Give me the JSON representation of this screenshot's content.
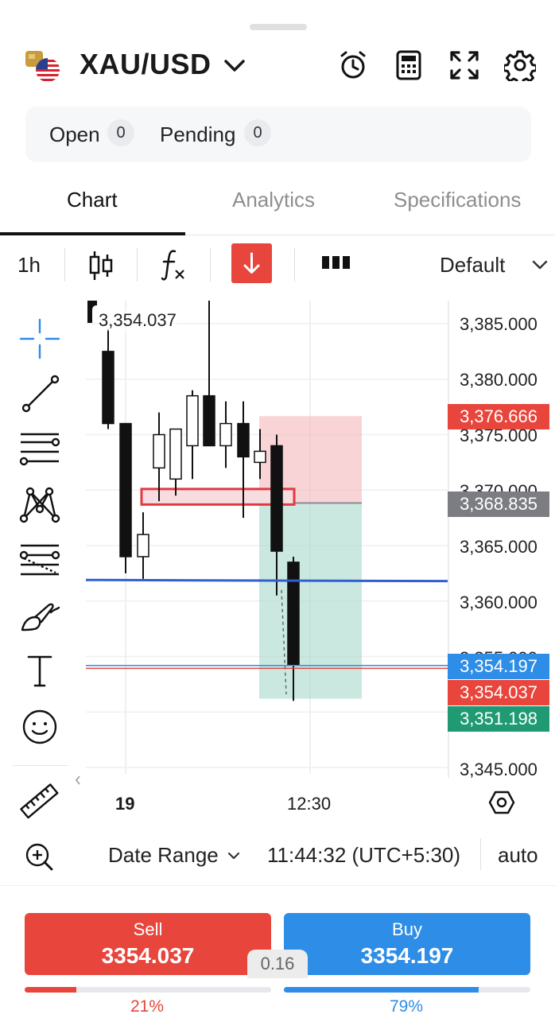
{
  "header": {
    "symbol": "XAU/USD",
    "icons": [
      "coin-flag-icon",
      "chevron-down-icon",
      "alarm-clock-icon",
      "calculator-icon",
      "fullscreen-icon",
      "gear-icon"
    ]
  },
  "orders": {
    "open_label": "Open",
    "open_count": "0",
    "pending_label": "Pending",
    "pending_count": "0"
  },
  "tabs": [
    {
      "label": "Chart",
      "active": true
    },
    {
      "label": "Analytics",
      "active": false
    },
    {
      "label": "Specifications",
      "active": false
    }
  ],
  "toolbar": {
    "interval": "1h",
    "icons": [
      "candlestick-icon",
      "function-icon",
      "sell-arrow-icon",
      "bars-icon",
      "chevron-down-icon"
    ],
    "template": "Default"
  },
  "drawing_tools": [
    "crosshair-icon",
    "trendline-icon",
    "horizontal-lines-icon",
    "pattern-icon",
    "fib-icon",
    "brush-icon",
    "text-icon",
    "emoji-icon",
    "ruler-icon",
    "zoom-in-icon"
  ],
  "chart": {
    "crosshair_price": "3,354.037",
    "y_labels": [
      "3,385.000",
      "3,380.000",
      "3,375.000",
      "3,370.000",
      "3,365.000",
      "3,360.000",
      "3,355.000",
      "3,345.000"
    ],
    "x_labels": [
      "19",
      "12:30"
    ],
    "price_tags": [
      {
        "text": "3,376.666",
        "color": "#e8453c"
      },
      {
        "text": "3,368.835",
        "color": "#7b7d82"
      },
      {
        "text": "3,354.197",
        "color": "#2e8de6"
      },
      {
        "text": "3,354.037",
        "color": "#e8453c"
      },
      {
        "text": "3,351.198",
        "color": "#1f9a73"
      }
    ],
    "colors": {
      "buy": "#2e8de6",
      "sell": "#e8453c",
      "level_line": "#2f5fd0",
      "target": "#1f9a73"
    }
  },
  "chart_data": {
    "type": "candlestick",
    "x_axis_labels": [
      "19",
      "12:30"
    ],
    "ylim": [
      3343,
      3387
    ],
    "candles": [
      {
        "open": 3382.5,
        "high": 3384.5,
        "low": 3375.5,
        "close": 3376.0
      },
      {
        "open": 3376.0,
        "high": 3376.0,
        "low": 3362.5,
        "close": 3364.0
      },
      {
        "open": 3364.0,
        "high": 3368.0,
        "low": 3362.0,
        "close": 3366.0
      },
      {
        "open": 3372.0,
        "high": 3377.0,
        "low": 3369.0,
        "close": 3375.0
      },
      {
        "open": 3371.0,
        "high": 3374.0,
        "low": 3369.5,
        "close": 3375.5
      },
      {
        "open": 3374.0,
        "high": 3379.0,
        "low": 3371.0,
        "close": 3378.5
      },
      {
        "open": 3378.5,
        "high": 3392.0,
        "low": 3374.0,
        "close": 3374.0
      },
      {
        "open": 3374.0,
        "high": 3378.0,
        "low": 3372.0,
        "close": 3376.0
      },
      {
        "open": 3376.0,
        "high": 3378.0,
        "low": 3367.5,
        "close": 3373.0
      },
      {
        "open": 3372.5,
        "high": 3375.5,
        "low": 3371.0,
        "close": 3373.5
      },
      {
        "open": 3374.0,
        "high": 3375.0,
        "low": 3360.5,
        "close": 3364.5
      },
      {
        "open": 3363.5,
        "high": 3364.0,
        "low": 3351.0,
        "close": 3354.2
      }
    ]
  },
  "bottom_bar": {
    "date_range": "Date Range",
    "time": "11:44:32 (UTC+5:30)",
    "scale": "auto"
  },
  "trade": {
    "sell_label": "Sell",
    "sell_price": "3354.037",
    "buy_label": "Buy",
    "buy_price": "3354.197",
    "spread": "0.16",
    "sell_pct": "21%",
    "buy_pct": "79%",
    "sell_fraction": 0.21,
    "buy_fraction": 0.79,
    "sell_color": "#e8453c",
    "buy_color": "#2e8de6"
  }
}
